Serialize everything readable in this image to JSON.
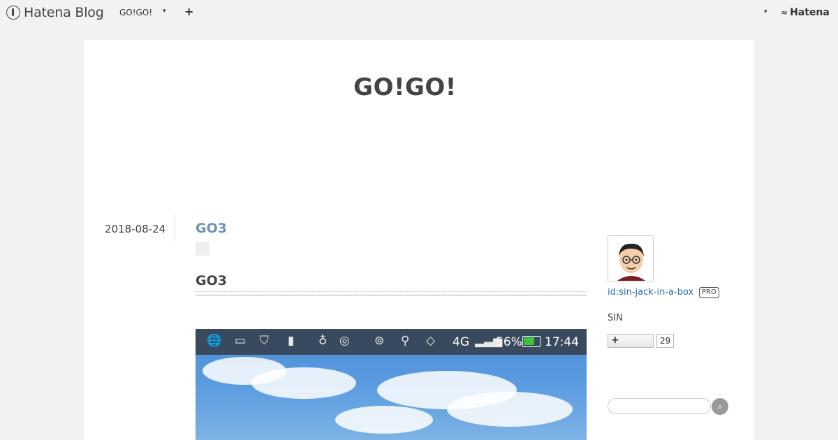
{
  "topbar": {
    "logo_text": "Hatena Blog",
    "blog_name": "GO!GO!",
    "caret": "▾",
    "add_label": "+",
    "brand": "Hatena"
  },
  "blog": {
    "title": "GO!GO!"
  },
  "entry": {
    "date": "2018-08-24",
    "title": "GO3",
    "heading": "GO3"
  },
  "photo_statusbar": {
    "net_type": "4G",
    "battery_percent": "56%",
    "time": "17:44"
  },
  "sidebar": {
    "profile_id": "id:sin-jack-in-a-box",
    "pro_label": "PRO",
    "name": "SIN",
    "subscribe_label": "+",
    "subscriber_count": "29"
  },
  "colors": {
    "accent_link": "#2a6fb0",
    "entry_title": "#6e92b5",
    "background": "#f2f2f2"
  },
  "icons": [
    "hatena-blog-logo-icon",
    "chevron-down-icon",
    "plus-icon",
    "hatena-logo-icon",
    "search-icon"
  ]
}
